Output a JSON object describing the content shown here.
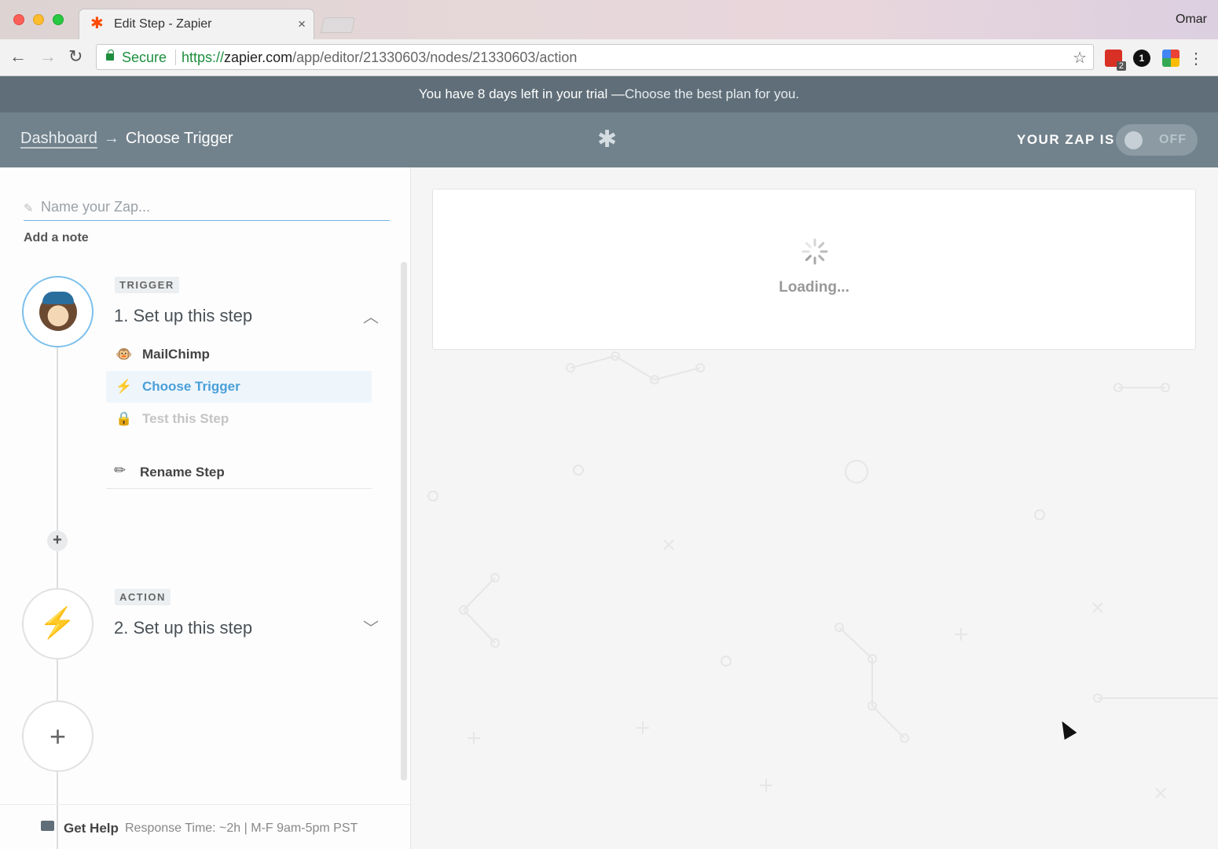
{
  "browser": {
    "tab_title": "Edit Step - Zapier",
    "tab_close": "×",
    "profile": "Omar",
    "secure_label": "Secure",
    "url_proto": "https://",
    "url_host": "zapier.com",
    "url_path": "/app/editor/21330603/nodes/21330603/action",
    "ext_badge": "2",
    "ext_count": "1"
  },
  "banner": {
    "lead": "You have 8 days left in your trial —",
    "cta": "Choose the best plan for you."
  },
  "header": {
    "breadcrumb_root": "Dashboard",
    "breadcrumb_arrow": "→",
    "breadcrumb_current": "Choose Trigger",
    "zap_status_label": "YOUR ZAP IS",
    "toggle_label": "OFF"
  },
  "sidebar": {
    "name_placeholder": "Name your Zap...",
    "add_note": "Add a note",
    "trigger": {
      "badge": "TRIGGER",
      "title": "1. Set up this step",
      "items": [
        {
          "label": "MailChimp",
          "icon": "mailchimp-icon"
        },
        {
          "label": "Choose Trigger",
          "icon": "bolt-icon"
        },
        {
          "label": "Test this Step",
          "icon": "lock-icon"
        }
      ],
      "rename": "Rename Step"
    },
    "action": {
      "badge": "ACTION",
      "title": "2. Set up this step"
    },
    "help": {
      "title": "Get Help",
      "response": "Response Time: ~2h | M-F 9am-5pm PST"
    }
  },
  "main": {
    "loading": "Loading..."
  },
  "colors": {
    "accent": "#4a9fd9",
    "header_bg": "#72828c",
    "banner_bg": "#5f6e78",
    "zapier_orange": "#ff4a00"
  }
}
